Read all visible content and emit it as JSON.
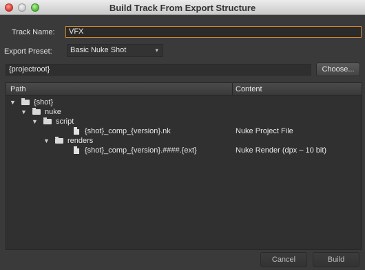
{
  "window": {
    "title": "Build Track From Export Structure"
  },
  "form": {
    "track_name_label": "Track Name:",
    "track_name_value": "VFX",
    "export_preset_label": "Export Preset:",
    "export_preset_value": "Basic Nuke Shot",
    "path_value": "{projectroot}",
    "choose_label": "Choose..."
  },
  "table": {
    "headers": {
      "path": "Path",
      "content": "Content"
    },
    "rows": [
      {
        "name": "{shot}",
        "content": ""
      },
      {
        "name": "nuke",
        "content": ""
      },
      {
        "name": "script",
        "content": ""
      },
      {
        "name": "{shot}_comp_{version}.nk",
        "content": "Nuke Project File"
      },
      {
        "name": "renders",
        "content": ""
      },
      {
        "name": "{shot}_comp_{version}.####.{ext}",
        "content": "Nuke Render (dpx – 10 bit)"
      }
    ]
  },
  "buttons": {
    "cancel": "Cancel",
    "build": "Build"
  },
  "icons": {
    "disclosure": "▼"
  }
}
